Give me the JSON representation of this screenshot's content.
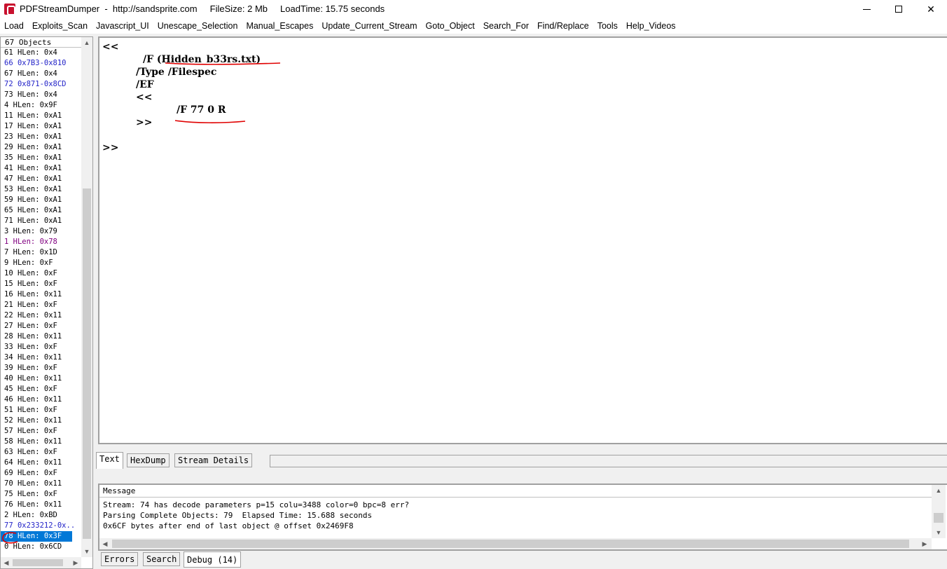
{
  "window": {
    "title": "PDFStreamDumper  -  http://sandsprite.com     FileSize: 2 Mb     LoadTime: 15.75 seconds"
  },
  "menu": [
    "Load",
    "Exploits_Scan",
    "Javascript_UI",
    "Unescape_Selection",
    "Manual_Escapes",
    "Update_Current_Stream",
    "Goto_Object",
    "Search_For",
    "Find/Replace",
    "Tools",
    "Help_Videos"
  ],
  "objects": {
    "header": "67 Objects",
    "items": [
      {
        "label": "61 HLen: 0x4",
        "color": "black"
      },
      {
        "label": "66 0x7B3-0x810",
        "color": "blue"
      },
      {
        "label": "67 HLen: 0x4",
        "color": "black"
      },
      {
        "label": "72 0x871-0x8CD",
        "color": "blue"
      },
      {
        "label": "73 HLen: 0x4",
        "color": "black"
      },
      {
        "label": "4 HLen: 0x9F",
        "color": "black"
      },
      {
        "label": "11 HLen: 0xA1",
        "color": "black"
      },
      {
        "label": "17 HLen: 0xA1",
        "color": "black"
      },
      {
        "label": "23 HLen: 0xA1",
        "color": "black"
      },
      {
        "label": "29 HLen: 0xA1",
        "color": "black"
      },
      {
        "label": "35 HLen: 0xA1",
        "color": "black"
      },
      {
        "label": "41 HLen: 0xA1",
        "color": "black"
      },
      {
        "label": "47 HLen: 0xA1",
        "color": "black"
      },
      {
        "label": "53 HLen: 0xA1",
        "color": "black"
      },
      {
        "label": "59 HLen: 0xA1",
        "color": "black"
      },
      {
        "label": "65 HLen: 0xA1",
        "color": "black"
      },
      {
        "label": "71 HLen: 0xA1",
        "color": "black"
      },
      {
        "label": "3 HLen: 0x79",
        "color": "black"
      },
      {
        "label": "1 HLen: 0x78",
        "color": "purple"
      },
      {
        "label": "7 HLen: 0x1D",
        "color": "black"
      },
      {
        "label": "9 HLen: 0xF",
        "color": "black"
      },
      {
        "label": "10 HLen: 0xF",
        "color": "black"
      },
      {
        "label": "15 HLen: 0xF",
        "color": "black"
      },
      {
        "label": "16 HLen: 0x11",
        "color": "black"
      },
      {
        "label": "21 HLen: 0xF",
        "color": "black"
      },
      {
        "label": "22 HLen: 0x11",
        "color": "black"
      },
      {
        "label": "27 HLen: 0xF",
        "color": "black"
      },
      {
        "label": "28 HLen: 0x11",
        "color": "black"
      },
      {
        "label": "33 HLen: 0xF",
        "color": "black"
      },
      {
        "label": "34 HLen: 0x11",
        "color": "black"
      },
      {
        "label": "39 HLen: 0xF",
        "color": "black"
      },
      {
        "label": "40 HLen: 0x11",
        "color": "black"
      },
      {
        "label": "45 HLen: 0xF",
        "color": "black"
      },
      {
        "label": "46 HLen: 0x11",
        "color": "black"
      },
      {
        "label": "51 HLen: 0xF",
        "color": "black"
      },
      {
        "label": "52 HLen: 0x11",
        "color": "black"
      },
      {
        "label": "57 HLen: 0xF",
        "color": "black"
      },
      {
        "label": "58 HLen: 0x11",
        "color": "black"
      },
      {
        "label": "63 HLen: 0xF",
        "color": "black"
      },
      {
        "label": "64 HLen: 0x11",
        "color": "black"
      },
      {
        "label": "69 HLen: 0xF",
        "color": "black"
      },
      {
        "label": "70 HLen: 0x11",
        "color": "black"
      },
      {
        "label": "75 HLen: 0xF",
        "color": "black"
      },
      {
        "label": "76 HLen: 0x11",
        "color": "black"
      },
      {
        "label": "2 HLen: 0xBD",
        "color": "black"
      },
      {
        "label": "77 0x233212-0x..",
        "color": "blue"
      },
      {
        "label": "78 HLen: 0x3F",
        "color": "selected"
      },
      {
        "label": "0 HLen: 0x6CD",
        "color": "black"
      }
    ]
  },
  "editor": {
    "lines": [
      "<<",
      "/F (Hidden_b33rs.txt)",
      "/Type /Filespec",
      "/EF",
      "<<",
      "/F 77 0 R",
      ">>",
      "",
      ">>"
    ]
  },
  "tabs": [
    "Text",
    "HexDump",
    "Stream Details"
  ],
  "messages": {
    "header": "Message",
    "lines": [
      "Stream: 74 has decode parameters p=15 colu=3488 color=0 bpc=8 err?",
      "Parsing Complete Objects: 79  Elapsed Time: 15.688 seconds",
      "0x6CF bytes after end of last object @ offset 0x2469F8"
    ]
  },
  "bottom_tabs": [
    "Errors",
    "Search",
    "Debug (14)"
  ],
  "colors": {
    "selection": "#0078d7",
    "annotation": "#e00000",
    "link_blue": "#2323c8",
    "purple": "#800080"
  }
}
